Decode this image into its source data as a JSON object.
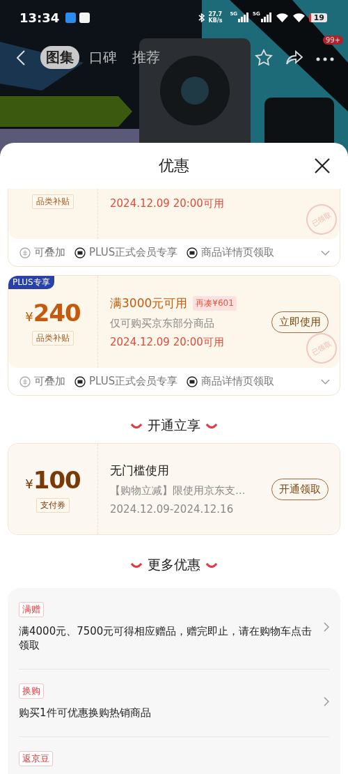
{
  "status_bar": {
    "time": "13:34",
    "net_speed": "27.7 KB/s",
    "signal_1": "5G",
    "signal_2": "5G",
    "battery": "19"
  },
  "nav": {
    "tabs": [
      {
        "label": "图集",
        "selected": true
      },
      {
        "label": "口碑",
        "selected": false
      },
      {
        "label": "推荐",
        "selected": false
      }
    ],
    "badge": "99+"
  },
  "sheet": {
    "title": "优惠"
  },
  "coupons": [
    {
      "label": "品类补贴",
      "time": "2024.12.09 20:00可用",
      "time_highlight": true,
      "stamp": "已领取",
      "tags": [
        "可叠加",
        "PLUS正式会员专享",
        "商品详情页领取"
      ]
    },
    {
      "badge": "PLUS专享",
      "currency": "¥",
      "amount": "240",
      "label": "品类补贴",
      "condition": "满3000元可用",
      "gap_tag": "再凑¥601",
      "scope": "仅可购买京东部分商品",
      "time": "2024.12.09 20:00可用",
      "time_highlight": true,
      "button": "立即使用",
      "stamp": "已领取",
      "tags": [
        "可叠加",
        "PLUS正式会员专享",
        "商品详情页领取"
      ]
    }
  ],
  "open_section": {
    "heading": "开通立享",
    "coupon": {
      "currency": "¥",
      "amount": "100",
      "label": "支付券",
      "condition": "无门槛使用",
      "scope": "【购物立减】限使用京东支…",
      "time": "2024.12.09-2024.12.16",
      "time_highlight": false,
      "button": "开通领取"
    }
  },
  "more_section": {
    "heading": "更多优惠",
    "items": [
      {
        "tag": "满赠",
        "text": "满4000元、7500元可得相应赠品，赠完即止，请在购物车点击领取"
      },
      {
        "tag": "换购",
        "text": "购买1件可优惠换购热销商品"
      },
      {
        "tag": "返京豆"
      }
    ]
  }
}
